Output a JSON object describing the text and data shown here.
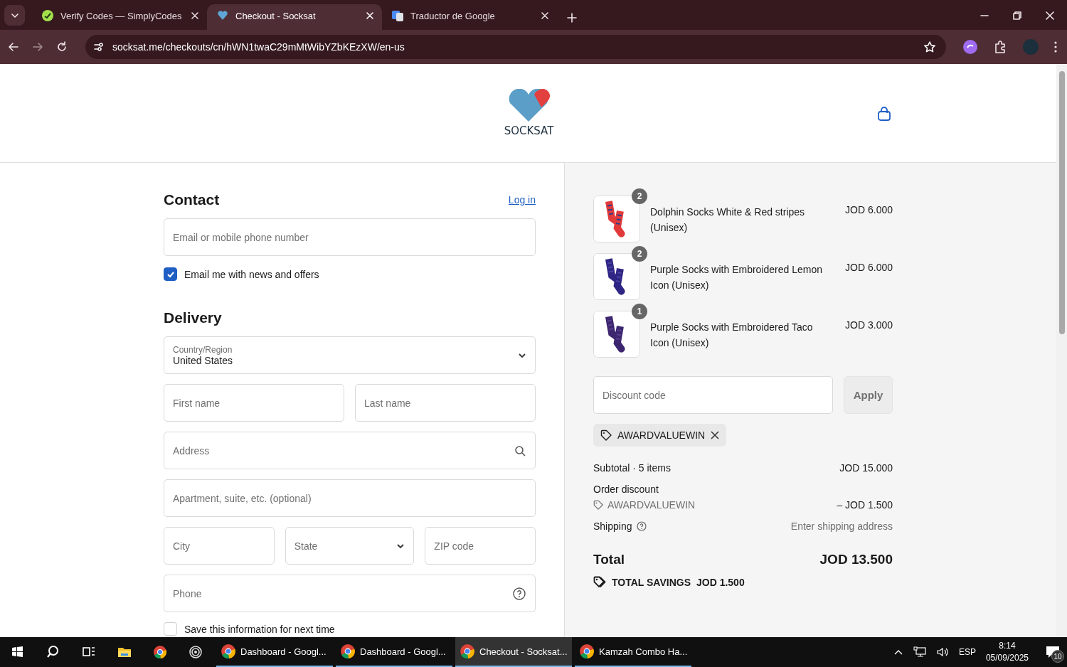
{
  "browser": {
    "tabs": [
      {
        "title": "Verify Codes — SimplyCodes",
        "selected": false
      },
      {
        "title": "Checkout - Socksat",
        "selected": true
      },
      {
        "title": "Traductor de Google",
        "selected": false
      }
    ],
    "url": "socksat.me/checkouts/cn/hWN1twaC29mMtWibYZbKEzXW/en-us"
  },
  "header": {
    "logo": "SOCKSAT"
  },
  "contact": {
    "heading": "Contact",
    "login": "Log in",
    "email_placeholder": "Email or mobile phone number",
    "newsletter": {
      "label": "Email me with news and offers",
      "checked": true
    }
  },
  "delivery": {
    "heading": "Delivery",
    "rows": [
      [
        {
          "kind": "select",
          "label": "Country/Region",
          "value": "United States"
        }
      ],
      [
        {
          "kind": "text",
          "placeholder": "First name"
        },
        {
          "kind": "text",
          "placeholder": "Last name"
        }
      ],
      [
        {
          "kind": "search",
          "placeholder": "Address"
        }
      ],
      [
        {
          "kind": "text",
          "placeholder": "Apartment, suite, etc. (optional)"
        }
      ],
      [
        {
          "kind": "text",
          "placeholder": "City"
        },
        {
          "kind": "select",
          "placeholder": "State"
        },
        {
          "kind": "text",
          "placeholder": "ZIP code"
        }
      ],
      [
        {
          "kind": "help",
          "placeholder": "Phone"
        }
      ]
    ],
    "save_info": {
      "label": "Save this information for next time",
      "checked": false
    }
  },
  "order": {
    "items": [
      {
        "quantity": "2",
        "name": "Dolphin Socks White & Red stripes (Unisex)",
        "price": "JOD 6.000"
      },
      {
        "quantity": "2",
        "name": "Purple Socks with Embroidered Lemon Icon (Unisex)",
        "price": "JOD 6.000"
      },
      {
        "quantity": "1",
        "name": "Purple Socks with Embroidered Taco Icon (Unisex)",
        "price": "JOD 3.000"
      }
    ],
    "discount": {
      "placeholder": "Discount code",
      "button": "Apply",
      "applied_code": "AWARDVALUEWIN"
    },
    "subtotal": {
      "label": "Subtotal · 5 items",
      "value": "JOD 15.000"
    },
    "order_discount": {
      "label": "Order discount",
      "code": "AWARDVALUEWIN",
      "value": "– JOD 1.500"
    },
    "shipping": {
      "label": "Shipping",
      "value": "Enter shipping address"
    },
    "total": {
      "label": "Total",
      "value": "JOD 13.500"
    },
    "savings": {
      "label": "TOTAL SAVINGS",
      "value": "JOD 1.500"
    }
  },
  "taskbar": {
    "windows": [
      {
        "title": "Dashboard - Googl...",
        "selected": false
      },
      {
        "title": "Dashboard - Googl...",
        "selected": false
      },
      {
        "title": "Checkout - Socksat...",
        "selected": true
      },
      {
        "title": "Kamzah Combo Ha...",
        "selected": false
      }
    ],
    "language": "ESP",
    "time": "8:14",
    "date": "05/09/2025",
    "notifications": "10"
  }
}
